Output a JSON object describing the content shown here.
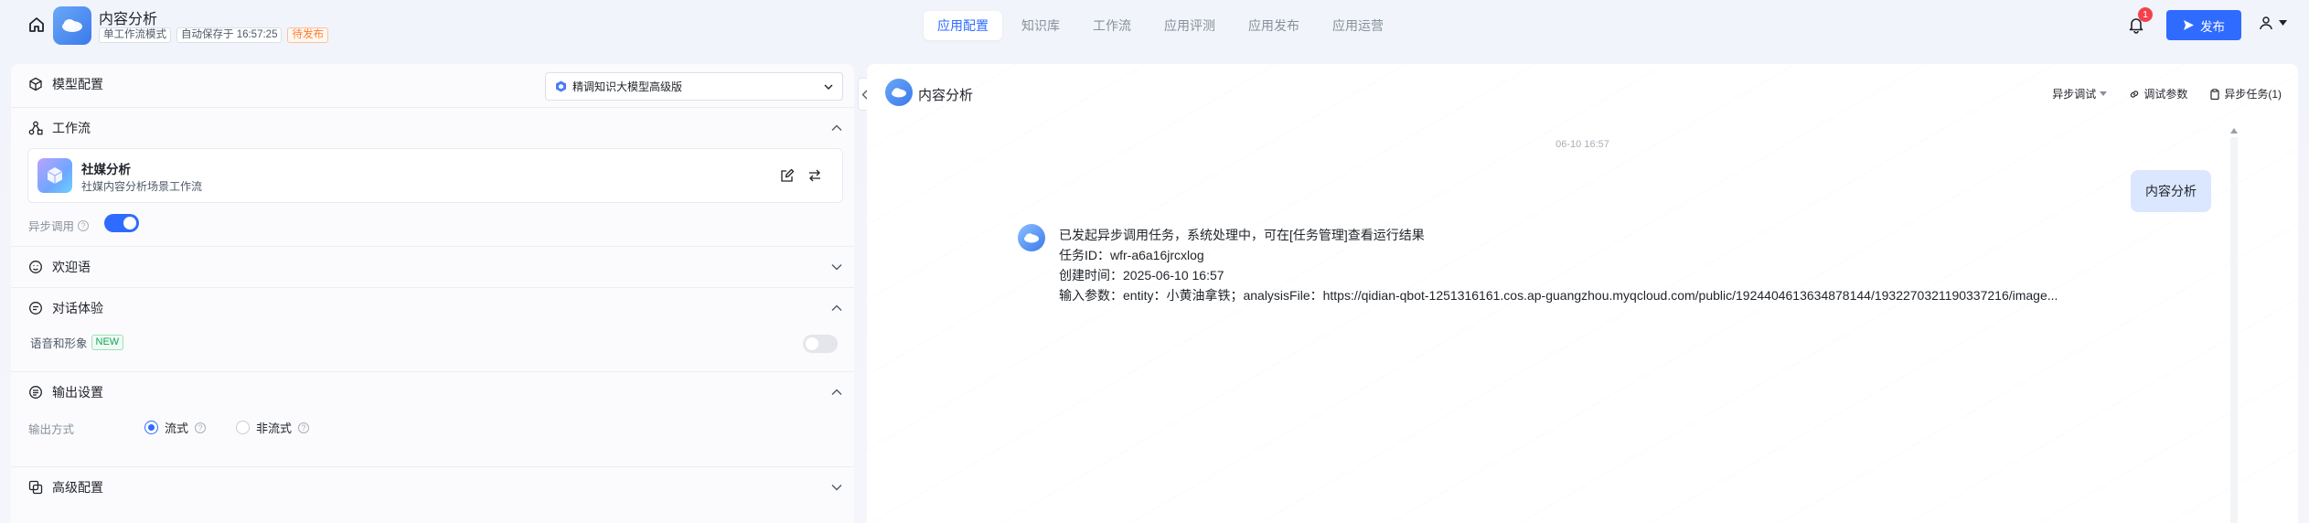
{
  "header": {
    "app_title": "内容分析",
    "mode_tag": "单工作流模式",
    "autosave": "自动保存于 16:57:25",
    "status_tag": "待发布",
    "nav": [
      "应用配置",
      "知识库",
      "工作流",
      "应用评测",
      "应用发布",
      "应用运营"
    ],
    "notification_count": "1",
    "publish_label": "发布",
    "icons": [
      "home-icon",
      "bell-icon",
      "send-icon",
      "user-icon"
    ]
  },
  "left": {
    "model_config": {
      "title": "模型配置",
      "model_value": "精调知识大模型高级版"
    },
    "workflow": {
      "title": "工作流",
      "card_name": "社媒分析",
      "card_desc": "社媒内容分析场景工作流",
      "async_label": "异步调用",
      "async_on": true
    },
    "welcome": {
      "title": "欢迎语"
    },
    "dialog": {
      "title": "对话体验",
      "voice_label": "语音和形象",
      "new_badge": "NEW",
      "voice_on": false
    },
    "output": {
      "title": "输出设置",
      "mode_label": "输出方式",
      "options": [
        "流式",
        "非流式"
      ],
      "selected": "流式"
    },
    "advanced": {
      "title": "高级配置"
    }
  },
  "right": {
    "title": "内容分析",
    "actions": {
      "async_debug": "异步调试",
      "debug_params": "调试参数",
      "async_tasks": "异步任务(1)"
    },
    "timestamp": "06-10 16:57",
    "user_message": "内容分析",
    "bot_lines": [
      "已发起异步调用任务，系统处理中，可在[任务管理]查看运行结果",
      "任务ID：wfr-a6a16jrcxlog",
      "创建时间：2025-06-10 16:57",
      "输入参数：entity：小黄油拿铁；analysisFile：https://qidian-qbot-1251316161.cos.ap-guangzhou.myqcloud.com/public/1924404613634878144/1932270321190337216/image..."
    ]
  },
  "colors": {
    "accent": "#2f6bff",
    "badge": "#f5414b",
    "pending": "#ff7d2a",
    "user_bubble": "#dbe7ff"
  }
}
